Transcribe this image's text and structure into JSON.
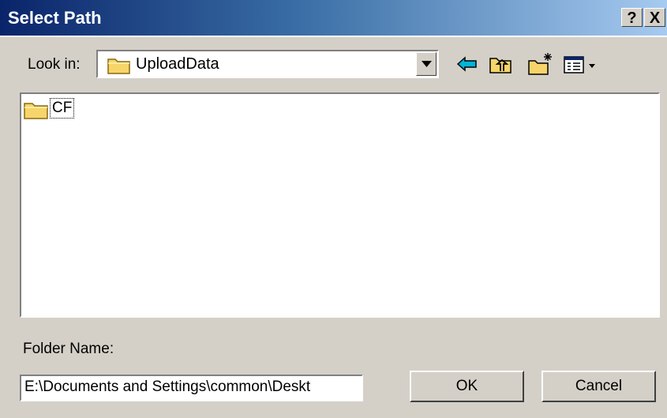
{
  "window": {
    "title": "Select Path",
    "help_label": "?",
    "close_label": "X"
  },
  "lookin": {
    "label": "Look in:",
    "value": "UploadData",
    "icon": "folder-icon"
  },
  "toolbar": {
    "icons": [
      "back-arrow-icon",
      "up-folder-icon",
      "new-folder-icon",
      "view-menu-icon"
    ]
  },
  "folders": [
    {
      "label": "CF",
      "icon": "folder-icon"
    }
  ],
  "folder_name": {
    "label": "Folder Name:",
    "value": "E:\\Documents and Settings\\common\\Deskt"
  },
  "buttons": {
    "ok": "OK",
    "cancel": "Cancel"
  },
  "colors": {
    "titlebar_start": "#0a246a",
    "titlebar_end": "#a6caf0",
    "face": "#d4d0c8",
    "folder_yellow": "#f7d56a",
    "back_arrow": "#00b4d8"
  }
}
